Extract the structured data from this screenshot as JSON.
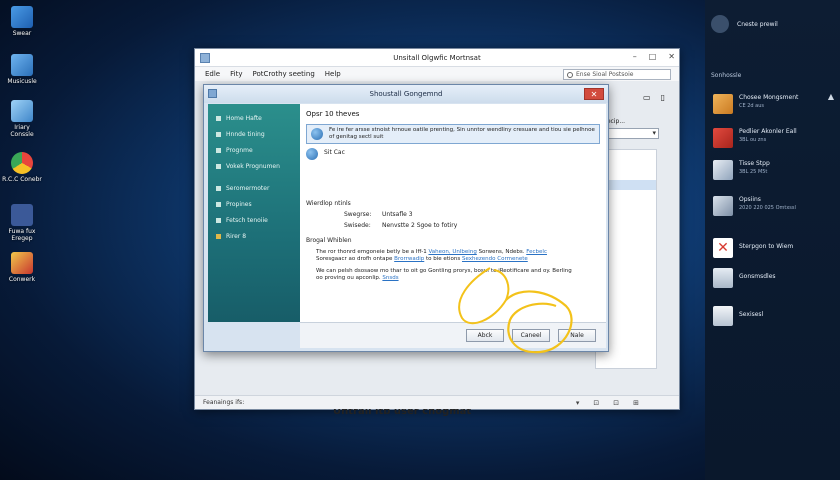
{
  "desktop": {
    "icons": [
      {
        "label": "Swear"
      },
      {
        "label": "Musicusle"
      },
      {
        "label": "Iriary Conssle"
      },
      {
        "label": "R.C.C Conebr"
      },
      {
        "label": "Fuwa fux Eregep"
      },
      {
        "label": "Conwerk"
      }
    ]
  },
  "side_panel": {
    "top_item": "Cneste prewil",
    "section_label": "Sonhossle",
    "items": [
      {
        "title": "Chosee Mongsment",
        "sub": "CE 2d aus"
      },
      {
        "title": "Pedlier Akonler Eall",
        "sub": "3BL ou zns"
      },
      {
        "title": "Tisse Stpp",
        "sub": "3BL 25 M5t"
      },
      {
        "title": "Opsiins",
        "sub": "2020 220 025 Omtxssl"
      },
      {
        "title": "Sterpgon to Wiem",
        "sub": ""
      },
      {
        "title": "Gonsmsdles",
        "sub": ""
      },
      {
        "title": "Sexisesl",
        "sub": ""
      }
    ],
    "colors": {
      "accent_red": "#d83a30",
      "accent_orange": "#e59a34"
    }
  },
  "main_window": {
    "title": "Unsitall Olgwfic Mortnsat",
    "menu": [
      "Edle",
      "Fity",
      "PotCrothy seeting",
      "Help"
    ],
    "search_placeholder": "Ense Sioal Postsoie",
    "right_label": "Precip...",
    "bottom_text": "Untrall itb user chogmat",
    "status_text": "Feanaings ifs:",
    "status_icons": [
      "▾",
      "⊡",
      "⊡",
      "⊞"
    ]
  },
  "dialog": {
    "title": "Shoustall Gongemnd",
    "close_label": "✕",
    "nav": [
      "Home Hafte",
      "Hnnde tining",
      "Prognme",
      "Vokek Prognumen",
      "Seromermoter",
      "Propines",
      "Fetsch tenoiie",
      "Rirer 8"
    ],
    "heading": "Opsr 10 theves",
    "option1_text": "Fe ire fer arsse stnoist hrnoue oatile prenting, Sin unntor wendliny cresuare and tiou sie pelhnoe of genitag sectl suit",
    "option2_text": "Sit Cac",
    "section1_title": "Wierdlop ntinls",
    "kv": [
      {
        "k": "Swegrse:",
        "v": "Untsafle 3"
      },
      {
        "k": "Swisede:",
        "v": "Nenvstte 2 Sgoe to fotiry"
      }
    ],
    "section2_title": "Brogal Whiblen",
    "para1_a": "The ror thonrd emgoneie betly be a Iff-1",
    "para1_link1": "Vaheon, Unlbeing",
    "para1_b": "Sorwens, Ndebs.",
    "para1_link2": "Fecbelc",
    "para1_c": "Soresgaacr ao drofh ontape",
    "para1_link3": "Brorrwadip",
    "para1_d": "to bie etions",
    "para1_link4": "Sexhezendo Cormenete",
    "para2_a": "We can pelsh dsosaow mo thar to oit go Gontling prorys, bosuf to iReotificare and oy. Berling oo proving ou apconlip.",
    "para2_link": "Snsds",
    "buttons": {
      "back": "Abck",
      "cancel": "Caneel",
      "next": "Nale"
    }
  },
  "annotation_color": "#f3c21a"
}
